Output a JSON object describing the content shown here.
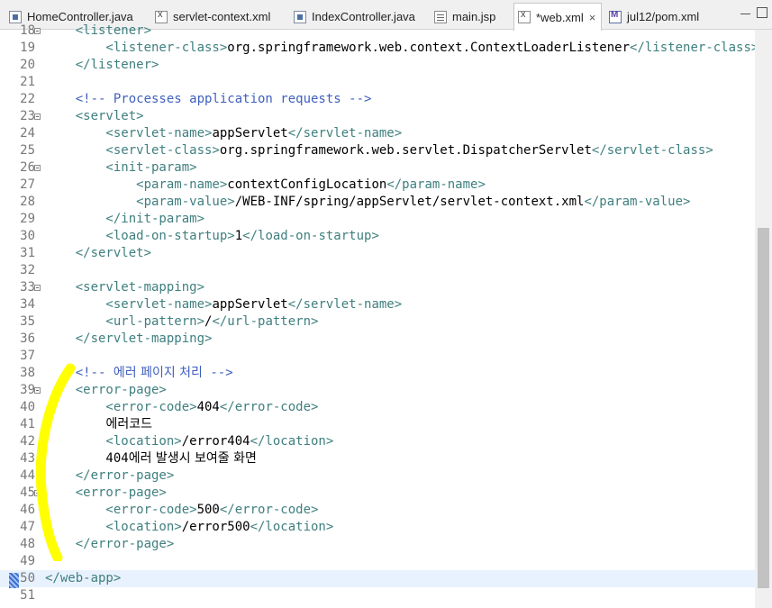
{
  "tabs": [
    {
      "label": "HomeController.java",
      "icon": "java-file-icon"
    },
    {
      "label": "servlet-context.xml",
      "icon": "xml-file-icon"
    },
    {
      "label": "IndexController.java",
      "icon": "java-file-icon"
    },
    {
      "label": "main.jsp",
      "icon": "jsp-file-icon"
    },
    {
      "label": "*web.xml",
      "icon": "xml-file-icon",
      "active": true,
      "close": "×"
    },
    {
      "label": "jul12/pom.xml",
      "icon": "pom-file-icon"
    }
  ],
  "editor": {
    "current_line": 50,
    "lines": [
      {
        "n": "18",
        "fold": true,
        "parts": [
          [
            "t",
            "    <listener>"
          ]
        ]
      },
      {
        "n": "19",
        "parts": [
          [
            "t",
            "        <listener-class>"
          ],
          [
            "x",
            "org.springframework.web.context.ContextLoaderListener"
          ],
          [
            "t",
            "</listener-class>"
          ]
        ]
      },
      {
        "n": "20",
        "parts": [
          [
            "t",
            "    </listener>"
          ]
        ]
      },
      {
        "n": "21",
        "parts": []
      },
      {
        "n": "22",
        "parts": [
          [
            "c",
            "    <!-- Processes application requests -->"
          ]
        ]
      },
      {
        "n": "23",
        "fold": true,
        "parts": [
          [
            "t",
            "    <servlet>"
          ]
        ]
      },
      {
        "n": "24",
        "parts": [
          [
            "t",
            "        <servlet-name>"
          ],
          [
            "x",
            "appServlet"
          ],
          [
            "t",
            "</servlet-name>"
          ]
        ]
      },
      {
        "n": "25",
        "parts": [
          [
            "t",
            "        <servlet-class>"
          ],
          [
            "x",
            "org.springframework.web.servlet.DispatcherServlet"
          ],
          [
            "t",
            "</servlet-class>"
          ]
        ]
      },
      {
        "n": "26",
        "fold": true,
        "parts": [
          [
            "t",
            "        <init-param>"
          ]
        ]
      },
      {
        "n": "27",
        "parts": [
          [
            "t",
            "            <param-name>"
          ],
          [
            "x",
            "contextConfigLocation"
          ],
          [
            "t",
            "</param-name>"
          ]
        ]
      },
      {
        "n": "28",
        "parts": [
          [
            "t",
            "            <param-value>"
          ],
          [
            "x",
            "/WEB-INF/spring/appServlet/servlet-context.xml"
          ],
          [
            "t",
            "</param-value>"
          ]
        ]
      },
      {
        "n": "29",
        "parts": [
          [
            "t",
            "        </init-param>"
          ]
        ]
      },
      {
        "n": "30",
        "parts": [
          [
            "t",
            "        <load-on-startup>"
          ],
          [
            "x",
            "1"
          ],
          [
            "t",
            "</load-on-startup>"
          ]
        ]
      },
      {
        "n": "31",
        "parts": [
          [
            "t",
            "    </servlet>"
          ]
        ]
      },
      {
        "n": "32",
        "parts": []
      },
      {
        "n": "33",
        "fold": true,
        "parts": [
          [
            "t",
            "    <servlet-mapping>"
          ]
        ]
      },
      {
        "n": "34",
        "parts": [
          [
            "t",
            "        <servlet-name>"
          ],
          [
            "x",
            "appServlet"
          ],
          [
            "t",
            "</servlet-name>"
          ]
        ]
      },
      {
        "n": "35",
        "parts": [
          [
            "t",
            "        <url-pattern>"
          ],
          [
            "x",
            "/"
          ],
          [
            "t",
            "</url-pattern>"
          ]
        ]
      },
      {
        "n": "36",
        "parts": [
          [
            "t",
            "    </servlet-mapping>"
          ]
        ]
      },
      {
        "n": "37",
        "parts": []
      },
      {
        "n": "38",
        "parts": [
          [
            "c",
            "    <!-- "
          ],
          [
            "ck",
            "에러 페이지 처리"
          ],
          [
            "c",
            " -->"
          ]
        ]
      },
      {
        "n": "39",
        "fold": true,
        "parts": [
          [
            "t",
            "    <error-page>"
          ]
        ]
      },
      {
        "n": "40",
        "parts": [
          [
            "t",
            "        <error-code>"
          ],
          [
            "x",
            "404"
          ],
          [
            "t",
            "</error-code>"
          ]
        ]
      },
      {
        "n": "41",
        "parts": [
          [
            "x",
            "        "
          ],
          [
            "xk",
            "에러코드"
          ]
        ]
      },
      {
        "n": "42",
        "parts": [
          [
            "t",
            "        <location>"
          ],
          [
            "x",
            "/error404"
          ],
          [
            "t",
            "</location>"
          ]
        ]
      },
      {
        "n": "43",
        "parts": [
          [
            "x",
            "        404"
          ],
          [
            "xk",
            "에러 발생시 보여줄 화면"
          ]
        ]
      },
      {
        "n": "44",
        "parts": [
          [
            "t",
            "    </error-page>"
          ]
        ]
      },
      {
        "n": "45",
        "fold": true,
        "parts": [
          [
            "t",
            "    <error-page>"
          ]
        ]
      },
      {
        "n": "46",
        "parts": [
          [
            "t",
            "        <error-code>"
          ],
          [
            "x",
            "500"
          ],
          [
            "t",
            "</error-code>"
          ]
        ]
      },
      {
        "n": "47",
        "parts": [
          [
            "t",
            "        <location>"
          ],
          [
            "x",
            "/error500"
          ],
          [
            "t",
            "</location>"
          ]
        ]
      },
      {
        "n": "48",
        "parts": [
          [
            "t",
            "    </error-page>"
          ]
        ]
      },
      {
        "n": "49",
        "parts": []
      },
      {
        "n": "50",
        "parts": [
          [
            "t",
            "</web-app>"
          ]
        ]
      },
      {
        "n": "51",
        "parts": []
      }
    ]
  },
  "colors": {
    "tag": "#3f7f7f",
    "comment": "#3f5fbf",
    "text": "#000000",
    "line_number": "#787878",
    "current_line_bg": "#e8f2fe",
    "annotation": "#ffff00"
  }
}
